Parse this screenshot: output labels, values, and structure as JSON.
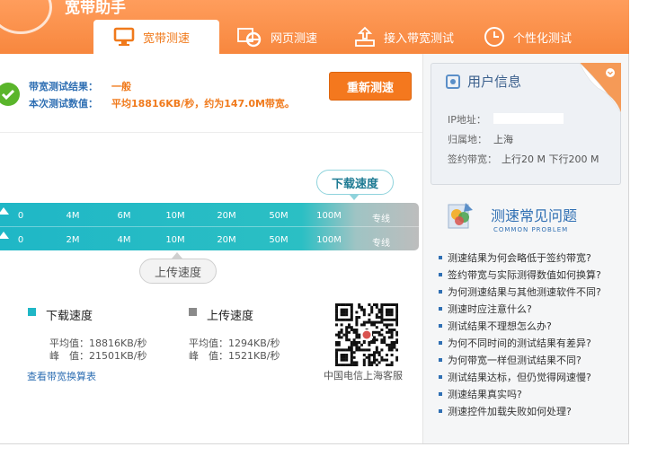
{
  "app": {
    "title": "宽带助手"
  },
  "tabs": [
    {
      "label": "宽带测速",
      "icon": "monitor-icon",
      "active": true
    },
    {
      "label": "网页测速",
      "icon": "ie-browser-icon",
      "active": false
    },
    {
      "label": "接入带宽测试",
      "icon": "access-tray-icon",
      "active": false
    },
    {
      "label": "个性化测试",
      "icon": "clock-icon",
      "active": false
    }
  ],
  "result": {
    "label_result": "带宽测试结果：",
    "value_result": "一般",
    "label_value": "本次测试数值：",
    "value_value": "平均18816KB/秒，约为147.0M带宽。",
    "retest_button": "重新测速",
    "status_icon": "check-circle-icon"
  },
  "speed_scale": {
    "download_bubble": "下载速度",
    "upload_bubble": "上传速度",
    "download_ticks": [
      "0",
      "4M",
      "6M",
      "10M",
      "20M",
      "50M",
      "100M",
      "专线"
    ],
    "upload_ticks": [
      "0",
      "2M",
      "4M",
      "10M",
      "20M",
      "50M",
      "100M",
      "专线"
    ]
  },
  "stats": {
    "download": {
      "title": "下载速度",
      "avg": "平均值：18816KB/秒",
      "peak": "峰　值：21501KB/秒",
      "color": "#1fb7c6"
    },
    "upload": {
      "title": "上传速度",
      "avg": "平均值：1294KB/秒",
      "peak": "峰　值：1521KB/秒",
      "color": "#8a8a8a"
    },
    "conversion_link": "查看带宽换算表",
    "qr_caption": "中国电信上海客服"
  },
  "user_info": {
    "title": "用户信息",
    "ip_label": "IP地址：",
    "ip_value": "",
    "location_label": "归属地：",
    "location_value": "上海",
    "bandwidth_label": "签约带宽：",
    "bandwidth_value": "上行20 M 下行200 M"
  },
  "faq": {
    "title": "测速常见问题",
    "subtitle": "COMMON PROBLEM",
    "items": [
      "测速结果为何会略低于签约带宽?",
      "签约带宽与实际测得数值如何换算?",
      "为何测速结果与其他测速软件不同?",
      "测速时应注意什么?",
      "测试结果不理想怎么办?",
      "为何不同时间的测试结果有差异?",
      "为何带宽一样但测试结果不同?",
      "测试结果达标，但仍觉得网速慢?",
      "测速结果真实吗?",
      "测速控件加载失败如何处理?"
    ]
  },
  "colors": {
    "header_orange": "#f7873e",
    "accent_orange": "#f07a1c",
    "link_blue": "#2f6fb3",
    "scale_teal": "#1fb7c6"
  }
}
